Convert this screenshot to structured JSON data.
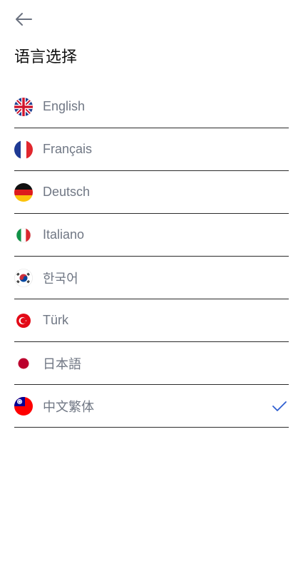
{
  "header": {
    "title": "语言选择",
    "back_icon": "arrow-left-icon"
  },
  "languages": [
    {
      "label": "English",
      "icon": "uk-flag-icon"
    },
    {
      "label": "Français",
      "icon": "france-flag-icon"
    },
    {
      "label": "Deutsch",
      "icon": "germany-flag-icon"
    },
    {
      "label": "Italiano",
      "icon": "italy-flag-icon"
    },
    {
      "label": "한국어",
      "icon": "korea-flag-icon"
    },
    {
      "label": "Türk",
      "icon": "turkey-flag-icon"
    },
    {
      "label": "日本語",
      "icon": "japan-flag-icon"
    },
    {
      "label": "中文繁体",
      "icon": "taiwan-flag-icon",
      "selected": true
    }
  ],
  "colors": {
    "label": "#707784",
    "divider": "#2b2b2b",
    "check": "#2f5fd0"
  }
}
